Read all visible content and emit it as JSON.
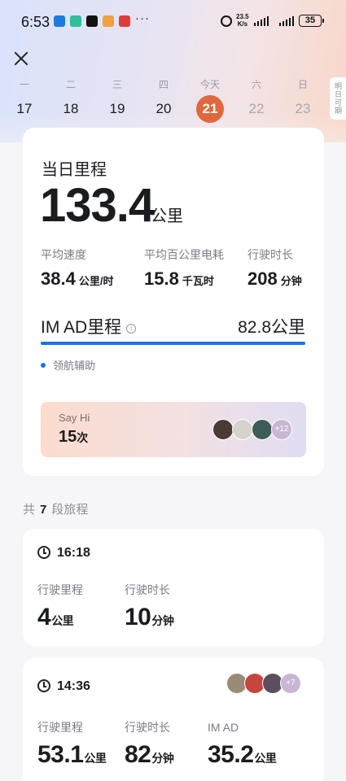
{
  "status_bar": {
    "time": "6:53",
    "more": "···",
    "net_speed_value": "23.5",
    "net_speed_unit": "K/s",
    "battery": "35"
  },
  "date_strip": {
    "days": [
      {
        "weekday": "一",
        "date": "17"
      },
      {
        "weekday": "二",
        "date": "18"
      },
      {
        "weekday": "三",
        "date": "19"
      },
      {
        "weekday": "四",
        "date": "20"
      },
      {
        "weekday": "今天",
        "date": "21"
      },
      {
        "weekday": "六",
        "date": "22"
      },
      {
        "weekday": "日",
        "date": "23"
      }
    ],
    "selected_index": 4,
    "tomorrow_tab": "明日可期",
    "selected_color": "#e1683e"
  },
  "summary": {
    "title": "当日里程",
    "distance": "133.4",
    "distance_unit": "公里",
    "stats": [
      {
        "label": "平均速度",
        "value": "38.4",
        "unit": "公里/时"
      },
      {
        "label": "平均百公里电耗",
        "value": "15.8",
        "unit": "千瓦时"
      },
      {
        "label": "行驶时长",
        "value": "208",
        "unit": "分钟"
      }
    ],
    "imad": {
      "title": "IM AD里程",
      "info_icon": "i",
      "value": "82.8公里",
      "bar_fraction": 1.0,
      "bar_color": "#1a73e8",
      "legend": "领航辅助"
    },
    "sayhi": {
      "label": "Say Hi",
      "count": "15",
      "count_unit": "次",
      "more": "+12"
    }
  },
  "trips_header": {
    "prefix": "共",
    "count": "7",
    "suffix": "段旅程"
  },
  "trips": [
    {
      "time": "16:18",
      "stats": [
        {
          "label": "行驶里程",
          "value": "4",
          "unit": "公里"
        },
        {
          "label": "行驶时长",
          "value": "10",
          "unit": "分钟"
        }
      ]
    },
    {
      "time": "14:36",
      "more": "+7",
      "stats": [
        {
          "label": "行驶里程",
          "value": "53.1",
          "unit": "公里"
        },
        {
          "label": "行驶时长",
          "value": "82",
          "unit": "分钟"
        },
        {
          "label": "IM AD",
          "value": "35.2",
          "unit": "公里"
        }
      ]
    }
  ]
}
